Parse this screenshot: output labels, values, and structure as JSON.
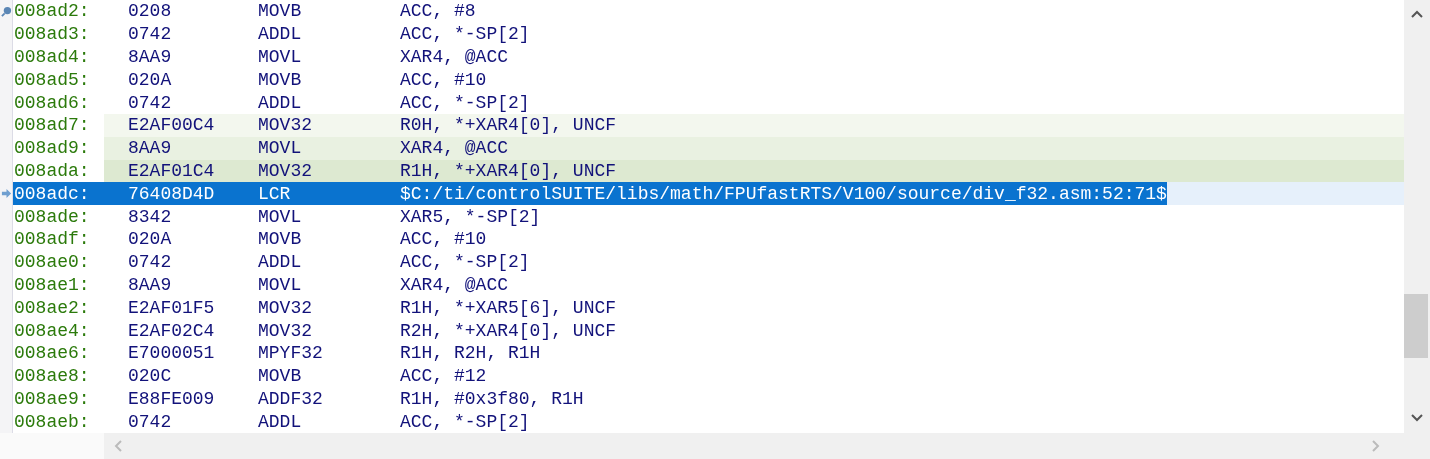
{
  "rows": [
    {
      "address": "008ad2:",
      "opcode": "0208",
      "mnemonic": "MOVB",
      "operands": "ACC, #8",
      "kind": "bookmark",
      "selected": false
    },
    {
      "address": "008ad3:",
      "opcode": "0742",
      "mnemonic": "ADDL",
      "operands": "ACC, *-SP[2]",
      "selected": false
    },
    {
      "address": "008ad4:",
      "opcode": "8AA9",
      "mnemonic": "MOVL",
      "operands": "XAR4, @ACC",
      "selected": false
    },
    {
      "address": "008ad5:",
      "opcode": "020A",
      "mnemonic": "MOVB",
      "operands": "ACC, #10",
      "selected": false
    },
    {
      "address": "008ad6:",
      "opcode": "0742",
      "mnemonic": "ADDL",
      "operands": "ACC, *-SP[2]",
      "selected": false
    },
    {
      "address": "008ad7:",
      "opcode": "E2AF00C4",
      "mnemonic": "MOV32",
      "operands": "R0H, *+XAR4[0], UNCF",
      "color": "#f3f7ee",
      "selected": false
    },
    {
      "address": "008ad9:",
      "opcode": "8AA9",
      "mnemonic": "MOVL",
      "operands": "XAR4, @ACC",
      "color": "#e9f1e1",
      "selected": false
    },
    {
      "address": "008ada:",
      "opcode": "E2AF01C4",
      "mnemonic": "MOV32",
      "operands": "R1H, *+XAR4[0], UNCF",
      "color": "#dde9d1",
      "selected": false
    },
    {
      "address": "008adc:",
      "opcode": "76408D4D",
      "mnemonic": "LCR",
      "operands": "$C:/ti/controlSUITE/libs/math/FPUfastRTS/V100/source/div_f32.asm:52:71$",
      "kind": "current",
      "selected": true
    },
    {
      "address": "008ade:",
      "opcode": "8342",
      "mnemonic": "MOVL",
      "operands": "XAR5, *-SP[2]",
      "selected": false
    },
    {
      "address": "008adf:",
      "opcode": "020A",
      "mnemonic": "MOVB",
      "operands": "ACC, #10",
      "selected": false
    },
    {
      "address": "008ae0:",
      "opcode": "0742",
      "mnemonic": "ADDL",
      "operands": "ACC, *-SP[2]",
      "selected": false
    },
    {
      "address": "008ae1:",
      "opcode": "8AA9",
      "mnemonic": "MOVL",
      "operands": "XAR4, @ACC",
      "selected": false
    },
    {
      "address": "008ae2:",
      "opcode": "E2AF01F5",
      "mnemonic": "MOV32",
      "operands": "R1H, *+XAR5[6], UNCF",
      "selected": false
    },
    {
      "address": "008ae4:",
      "opcode": "E2AF02C4",
      "mnemonic": "MOV32",
      "operands": "R2H, *+XAR4[0], UNCF",
      "selected": false
    },
    {
      "address": "008ae6:",
      "opcode": "E7000051",
      "mnemonic": "MPYF32",
      "operands": "R1H, R2H, R1H",
      "selected": false
    },
    {
      "address": "008ae8:",
      "opcode": "020C",
      "mnemonic": "MOVB",
      "operands": "ACC, #12",
      "selected": false
    },
    {
      "address": "008ae9:",
      "opcode": "E88FE009",
      "mnemonic": "ADDF32",
      "operands": "R1H, #0x3f80, R1H",
      "selected": false
    },
    {
      "address": "008aeb:",
      "opcode": "0742",
      "mnemonic": "ADDL",
      "operands": "ACC, *-SP[2]",
      "selected": false
    }
  ]
}
